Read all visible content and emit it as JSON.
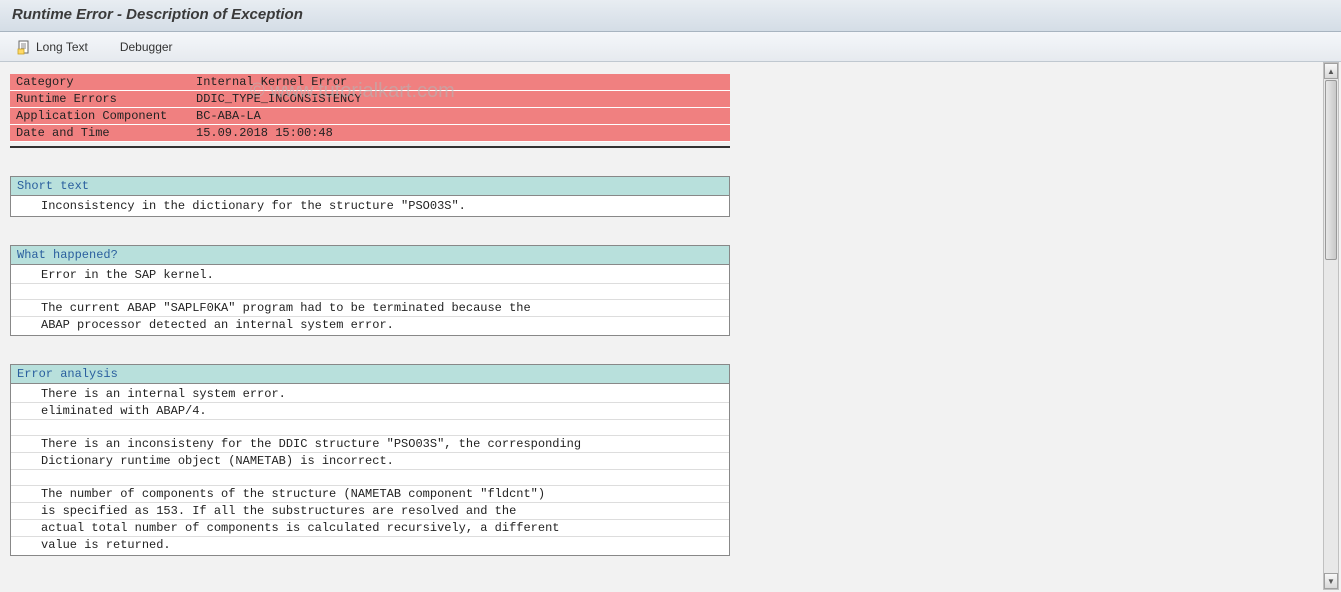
{
  "title": "Runtime Error - Description of Exception",
  "toolbar": {
    "longtext": "Long Text",
    "debugger": "Debugger"
  },
  "watermark": "© www.tutorialkart.com",
  "header": {
    "rows": [
      {
        "label": "Category",
        "value": "Internal Kernel Error"
      },
      {
        "label": "Runtime Errors",
        "value": "DDIC_TYPE_INCONSISTENCY"
      },
      {
        "label": "Application Component",
        "value": "BC-ABA-LA"
      },
      {
        "label": "Date and Time",
        "value": "15.09.2018 15:00:48"
      }
    ]
  },
  "sections": [
    {
      "title": "Short text",
      "lines": [
        "Inconsistency in the dictionary for the structure \"PSO03S\"."
      ]
    },
    {
      "title": "What happened?",
      "lines": [
        "Error in the SAP kernel.",
        "",
        "The current ABAP \"SAPLF0KA\" program had to be terminated because the",
        "ABAP processor detected an internal system error."
      ]
    },
    {
      "title": "Error analysis",
      "lines": [
        "There is an internal system error.",
        "eliminated with ABAP/4.",
        "",
        "There is an inconsisteny for the DDIC structure \"PSO03S\", the corresponding",
        "Dictionary runtime object (NAMETAB) is incorrect.",
        "",
        "The number of components of the structure (NAMETAB component \"fldcnt\")",
        "is specified as 153. If all the substructures are resolved and the",
        "actual total number of components is calculated recursively, a different",
        "value is returned."
      ]
    }
  ]
}
